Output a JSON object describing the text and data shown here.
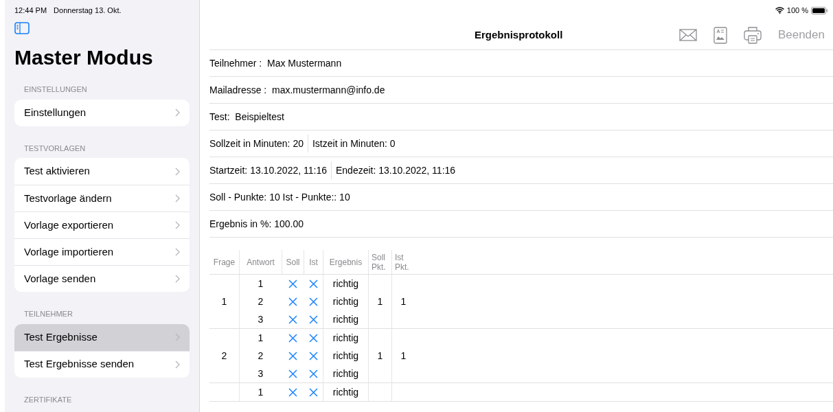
{
  "status_bar": {
    "time": "12:44 PM",
    "date": "Donnerstag 13. Okt.",
    "battery_text": "100 %"
  },
  "sidebar": {
    "title": "Master Modus",
    "sections": [
      {
        "header": "EINSTELLUNGEN",
        "items": [
          {
            "label": "Einstellungen",
            "selected": false
          }
        ]
      },
      {
        "header": "TESTVORLAGEN",
        "items": [
          {
            "label": "Test aktivieren",
            "selected": false
          },
          {
            "label": "Testvorlage ändern",
            "selected": false
          },
          {
            "label": "Vorlage exportieren",
            "selected": false
          },
          {
            "label": "Vorlage importieren",
            "selected": false
          },
          {
            "label": "Vorlage senden",
            "selected": false
          }
        ]
      },
      {
        "header": "TEILNEHMER",
        "items": [
          {
            "label": "Test Ergebnisse",
            "selected": true
          },
          {
            "label": "Test Ergebnisse senden",
            "selected": false
          }
        ]
      },
      {
        "header": "ZERTIFIKATE"
      }
    ]
  },
  "nav": {
    "title": "Ergebnisprotokoll",
    "done_button": "Beenden"
  },
  "info_rows": [
    [
      "Teilnehmer :  Max Mustermann"
    ],
    [
      "Mailadresse :  max.mustermann@info.de"
    ],
    [
      "Test:  Beispieltest"
    ],
    [
      "Sollzeit in Minuten: 20",
      "Istzeit in Minuten: 0"
    ],
    [
      "Startzeit: 13.10.2022, 11:16",
      "Endezeit: 13.10.2022, 11:16"
    ],
    [
      "Soll - Punkte: 10 Ist - Punkte:: 10"
    ],
    [
      "Ergebnis in %: 100.00"
    ]
  ],
  "table": {
    "columns": [
      "Frage",
      "Antwort",
      "Soll",
      "Ist",
      "Ergebnis",
      "Soll\nPkt.",
      "Ist\nPkt."
    ],
    "groups": [
      {
        "question": "1",
        "soll_points": "1",
        "ist_points": "1",
        "answers": [
          {
            "answer": "1",
            "soll": true,
            "ist": true,
            "result": "richtig"
          },
          {
            "answer": "2",
            "soll": true,
            "ist": true,
            "result": "richtig"
          },
          {
            "answer": "3",
            "soll": true,
            "ist": true,
            "result": "richtig"
          }
        ]
      },
      {
        "question": "2",
        "soll_points": "1",
        "ist_points": "1",
        "answers": [
          {
            "answer": "1",
            "soll": true,
            "ist": true,
            "result": "richtig"
          },
          {
            "answer": "2",
            "soll": true,
            "ist": true,
            "result": "richtig"
          },
          {
            "answer": "3",
            "soll": true,
            "ist": true,
            "result": "richtig"
          }
        ]
      },
      {
        "answers": [
          {
            "answer": "1",
            "soll": true,
            "ist": true,
            "result": "richtig"
          }
        ]
      }
    ]
  }
}
